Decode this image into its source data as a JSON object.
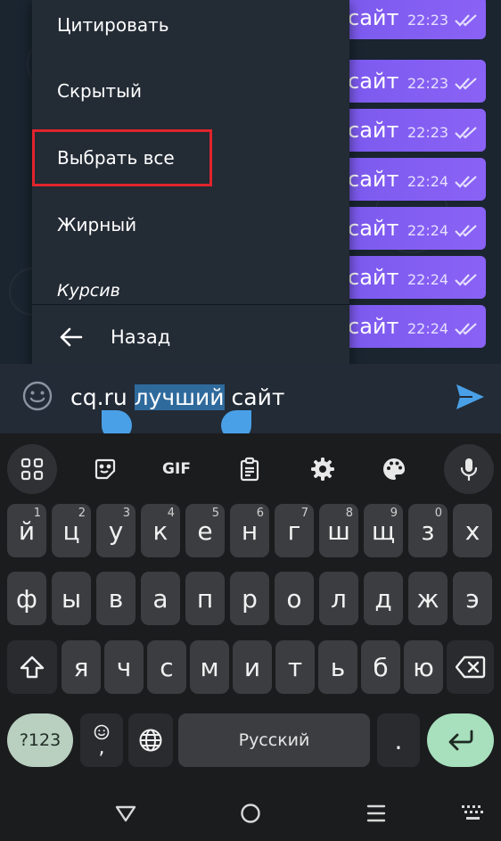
{
  "chat": {
    "messages": [
      {
        "text": "сайт",
        "time": "22:23"
      },
      {
        "text": "сайт",
        "time": "22:23"
      },
      {
        "text": "сайт",
        "time": "22:23"
      },
      {
        "text": "сайт",
        "time": "22:24"
      },
      {
        "text": "сайт",
        "time": "22:24"
      },
      {
        "text": "сайт",
        "time": "22:24"
      },
      {
        "text": "сайт",
        "time": "22:24"
      }
    ]
  },
  "context_menu": {
    "items": [
      "Цитировать",
      "Скрытый",
      "Выбрать все",
      "Жирный",
      "Курсив"
    ],
    "highlighted_item": "Выбрать все",
    "back_label": "Назад"
  },
  "composer": {
    "text_before": "cq.ru ",
    "text_selected": "лучший",
    "text_after": " сайт"
  },
  "keyboard": {
    "toolbar": [
      "apps-grid-icon",
      "sticker-icon",
      "GIF",
      "clipboard-icon",
      "gear-icon",
      "palette-icon",
      "mic-icon"
    ],
    "row1": [
      {
        "label": "й",
        "hint": "1"
      },
      {
        "label": "ц",
        "hint": "2"
      },
      {
        "label": "у",
        "hint": "3"
      },
      {
        "label": "к",
        "hint": "4"
      },
      {
        "label": "е",
        "hint": "5"
      },
      {
        "label": "н",
        "hint": "6"
      },
      {
        "label": "г",
        "hint": "7"
      },
      {
        "label": "ш",
        "hint": "8"
      },
      {
        "label": "щ",
        "hint": "9"
      },
      {
        "label": "з",
        "hint": "0"
      },
      {
        "label": "х",
        "hint": ""
      }
    ],
    "row2": [
      "ф",
      "ы",
      "в",
      "а",
      "п",
      "р",
      "о",
      "л",
      "д",
      "ж",
      "э"
    ],
    "row3": [
      "я",
      "ч",
      "с",
      "м",
      "и",
      "т",
      "ь",
      "б",
      "ю"
    ],
    "symbols_label": "?123",
    "emoji_comma_label": ",",
    "space_label": "Русский",
    "period_label": "."
  },
  "colors": {
    "bubble": "#7b5af0",
    "accent": "#4aa0e6",
    "highlight_border": "#e0242d",
    "enter_key": "#a8dfbd"
  }
}
